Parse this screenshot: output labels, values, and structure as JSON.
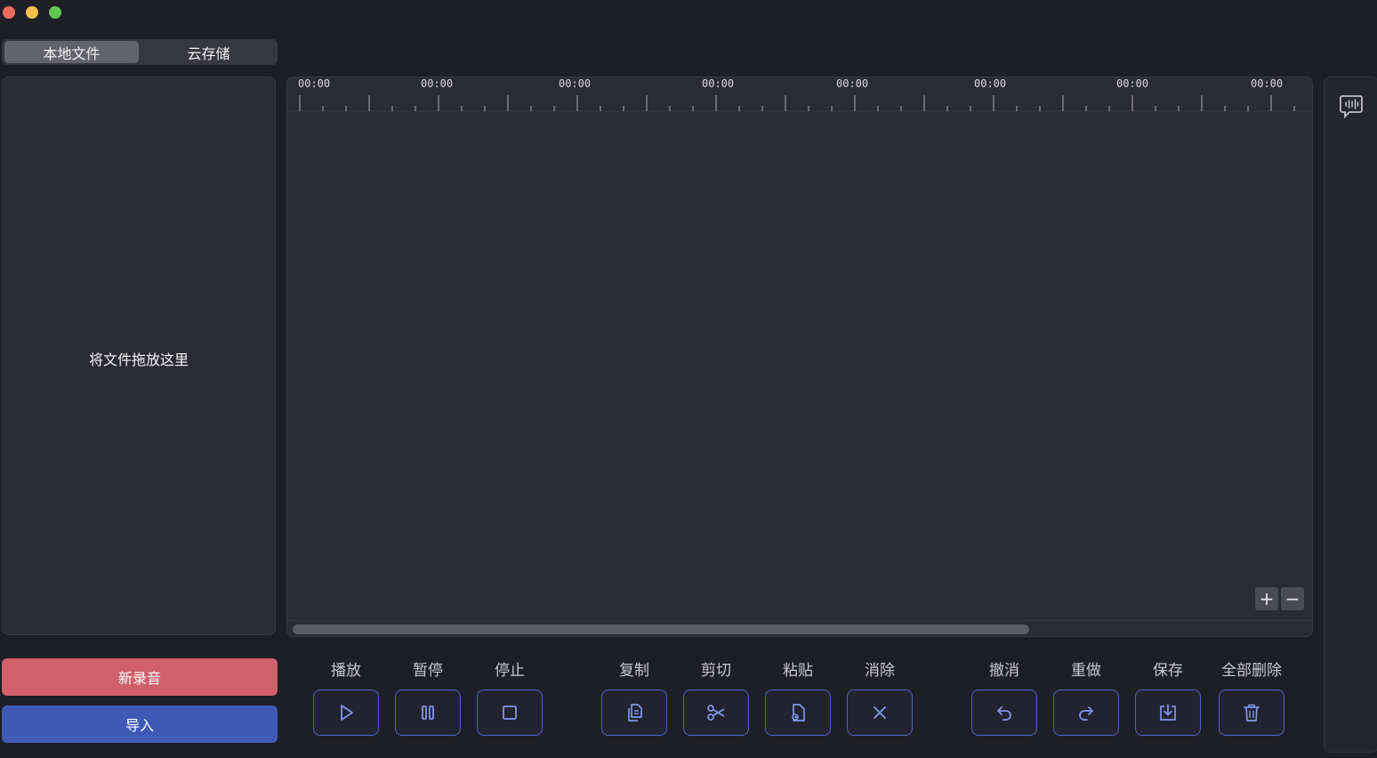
{
  "window": {
    "controls": [
      "close",
      "minimize",
      "maximize"
    ]
  },
  "tabs": [
    {
      "label": "本地文件",
      "active": true
    },
    {
      "label": "云存储",
      "active": false
    }
  ],
  "file_panel": {
    "drop_text": "将文件拖放这里"
  },
  "actions": {
    "new_recording": "新录音",
    "import": "导入"
  },
  "timeline": {
    "ruler_labels": [
      "00:00",
      "00:00",
      "00:00",
      "00:00",
      "00:00",
      "00:00",
      "00:00",
      "00:00"
    ],
    "zoom_in": "+",
    "zoom_out": "−"
  },
  "controls": [
    {
      "label": "播放",
      "icon": "play-icon"
    },
    {
      "label": "暂停",
      "icon": "pause-icon"
    },
    {
      "label": "停止",
      "icon": "stop-icon"
    },
    {
      "label": "复制",
      "icon": "copy-icon"
    },
    {
      "label": "剪切",
      "icon": "scissors-icon"
    },
    {
      "label": "粘贴",
      "icon": "paste-icon"
    },
    {
      "label": "消除",
      "icon": "close-icon"
    },
    {
      "label": "撤消",
      "icon": "undo-icon"
    },
    {
      "label": "重做",
      "icon": "redo-icon"
    },
    {
      "label": "保存",
      "icon": "save-icon"
    },
    {
      "label": "全部删除",
      "icon": "trash-icon"
    }
  ],
  "colors": {
    "background": "#1e1f25",
    "panel": "#2a2b33",
    "record_button": "#d0606a",
    "import_button": "#3f5ab5",
    "accent_border": "#4a63c9"
  },
  "right_sidebar": {
    "icon": "transcription-icon"
  }
}
